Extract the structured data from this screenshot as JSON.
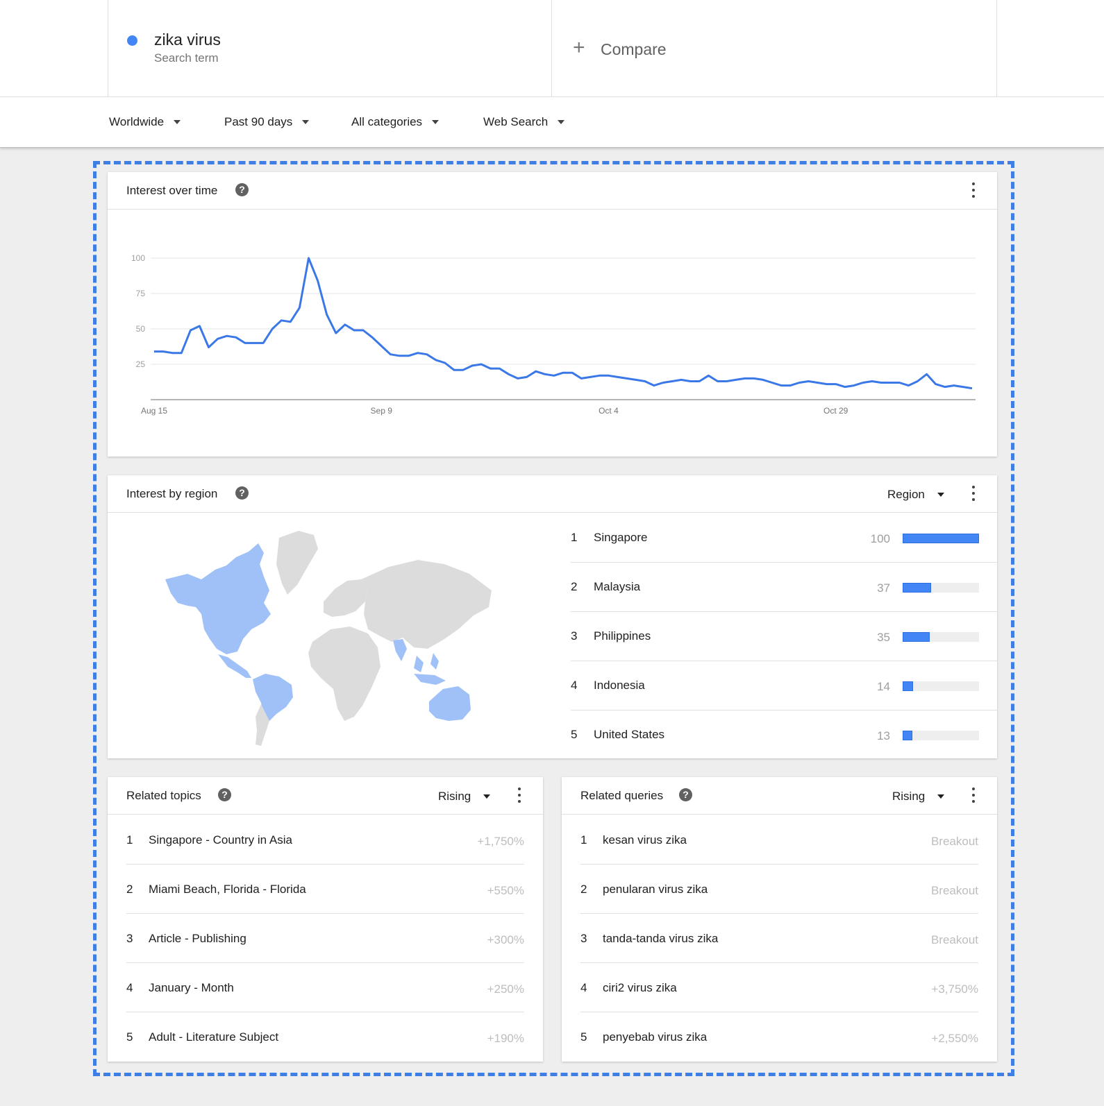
{
  "header": {
    "term_name": "zika virus",
    "term_type": "Search term",
    "term_color": "#4285f4",
    "compare_icon": "plus-icon",
    "compare_label": "Compare"
  },
  "filters": {
    "geo": "Worldwide",
    "time": "Past 90 days",
    "category": "All categories",
    "property": "Web Search"
  },
  "interest_over_time": {
    "title": "Interest over time"
  },
  "chart_data": {
    "type": "line",
    "title": "",
    "xlabel": "",
    "ylabel": "",
    "ylim": [
      0,
      100
    ],
    "yticks": [
      25,
      50,
      75,
      100
    ],
    "xtick_labels": [
      "Aug 15",
      "Sep 9",
      "Oct 4",
      "Oct 29"
    ],
    "xtick_index": [
      0,
      25,
      50,
      75
    ],
    "grid": true,
    "series": [
      {
        "color": "#3b78e7",
        "values": [
          34,
          34,
          33,
          33,
          49,
          52,
          37,
          43,
          45,
          44,
          40,
          40,
          40,
          50,
          56,
          55,
          65,
          100,
          84,
          60,
          47,
          53,
          49,
          49,
          44,
          38,
          32,
          31,
          31,
          33,
          32,
          28,
          26,
          21,
          21,
          24,
          25,
          22,
          22,
          18,
          15,
          16,
          20,
          18,
          17,
          19,
          19,
          15,
          16,
          17,
          17,
          16,
          15,
          14,
          13,
          10,
          12,
          13,
          14,
          13,
          13,
          17,
          13,
          13,
          14,
          15,
          15,
          14,
          12,
          10,
          10,
          12,
          13,
          12,
          11,
          11,
          9,
          10,
          12,
          13,
          12,
          12,
          12,
          10,
          13,
          18,
          11,
          9,
          10,
          9,
          8
        ]
      }
    ]
  },
  "interest_by_region": {
    "title": "Interest by region",
    "selector": "Region",
    "map_colors": {
      "high": "#a0c1f7",
      "none": "#dcdcdc"
    },
    "rows": [
      {
        "rank": "1",
        "name": "Singapore",
        "value": "100",
        "score": 100
      },
      {
        "rank": "2",
        "name": "Malaysia",
        "value": "37",
        "score": 37
      },
      {
        "rank": "3",
        "name": "Philippines",
        "value": "35",
        "score": 35
      },
      {
        "rank": "4",
        "name": "Indonesia",
        "value": "14",
        "score": 14
      },
      {
        "rank": "5",
        "name": "United States",
        "value": "13",
        "score": 13
      }
    ]
  },
  "related_topics": {
    "title": "Related topics",
    "selector": "Rising",
    "rows": [
      {
        "rank": "1",
        "name": "Singapore - Country in Asia",
        "value": "+1,750%"
      },
      {
        "rank": "2",
        "name": "Miami Beach, Florida - Florida",
        "value": "+550%"
      },
      {
        "rank": "3",
        "name": "Article - Publishing",
        "value": "+300%"
      },
      {
        "rank": "4",
        "name": "January - Month",
        "value": "+250%"
      },
      {
        "rank": "5",
        "name": "Adult - Literature Subject",
        "value": "+190%"
      }
    ]
  },
  "related_queries": {
    "title": "Related queries",
    "selector": "Rising",
    "rows": [
      {
        "rank": "1",
        "name": "kesan virus zika",
        "value": "Breakout"
      },
      {
        "rank": "2",
        "name": "penularan virus zika",
        "value": "Breakout"
      },
      {
        "rank": "3",
        "name": "tanda-tanda virus zika",
        "value": "Breakout"
      },
      {
        "rank": "4",
        "name": "ciri2 virus zika",
        "value": "+3,750%"
      },
      {
        "rank": "5",
        "name": "penyebab virus zika",
        "value": "+2,550%"
      }
    ]
  }
}
